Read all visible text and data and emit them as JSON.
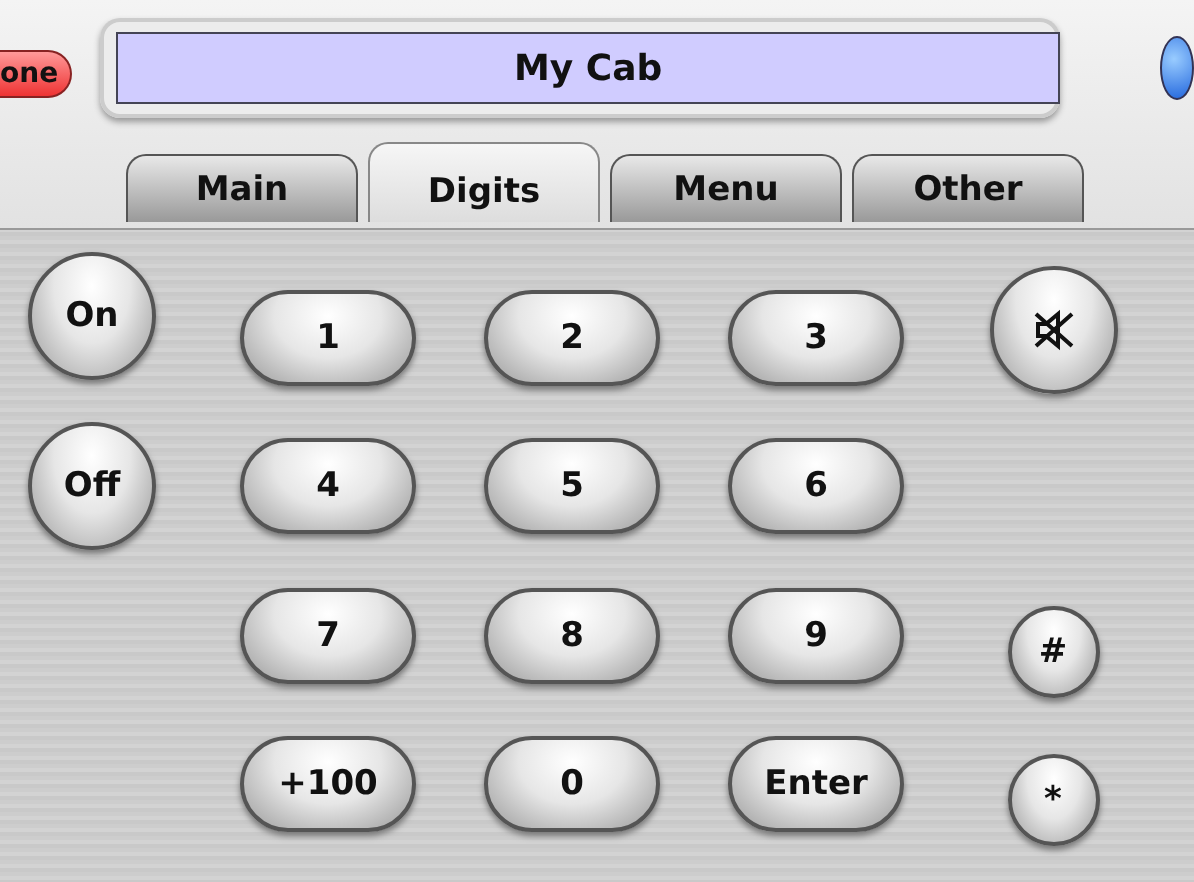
{
  "header": {
    "left_button": "one",
    "title": "My Cab"
  },
  "tabs": [
    {
      "label": "Main",
      "selected": false
    },
    {
      "label": "Digits",
      "selected": true
    },
    {
      "label": "Menu",
      "selected": false
    },
    {
      "label": "Other",
      "selected": false
    }
  ],
  "rows": [
    {
      "left": {
        "label": "On"
      },
      "keys": [
        "1",
        "2",
        "3"
      ],
      "right": {
        "kind": "mute"
      }
    },
    {
      "left": {
        "label": "Off"
      },
      "keys": [
        "4",
        "5",
        "6"
      ]
    },
    {
      "keys": [
        "7",
        "8",
        "9"
      ],
      "right": {
        "kind": "text",
        "label": "#"
      }
    },
    {
      "keys": [
        "+100",
        "0",
        "Enter"
      ],
      "right": {
        "kind": "text",
        "label": "*"
      }
    }
  ]
}
